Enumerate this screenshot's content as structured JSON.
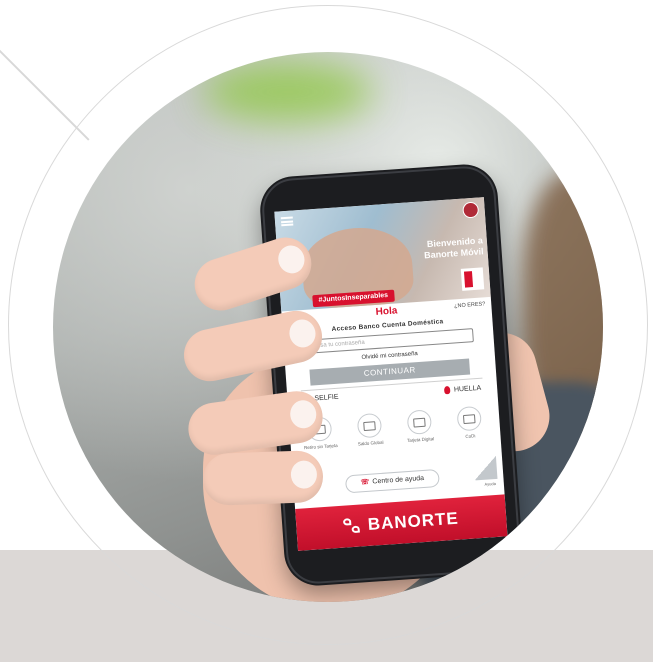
{
  "app": {
    "greeting": "Hola",
    "not_you": "¿NO ERES?",
    "access_text": "Acceso Banco Cuenta Doméstica",
    "password_placeholder": "Ingresa tu contraseña",
    "forgot_password": "Olvidé mi contraseña",
    "continue_label": "CONTINUAR",
    "selfie_label": "SELFIE",
    "fingerprint_label": "HUELLA",
    "hero": {
      "title": "Bienvenido a Banorte Móvil",
      "tagline": "#JuntosInseparables"
    },
    "quick_actions": [
      {
        "label": "Retiro sin Tarjeta",
        "icon": "cash-icon"
      },
      {
        "label": "Saldo Global",
        "icon": "money-icon"
      },
      {
        "label": "Tarjeta Digital",
        "icon": "card-icon"
      },
      {
        "label": "CoDi",
        "icon": "codi-icon"
      }
    ],
    "help_center": "Centro de ayuda",
    "curl_label": "Ayuda",
    "brand": "BANORTE"
  },
  "colors": {
    "brand_red": "#d8112e",
    "button_gray": "#a7adb1",
    "bottom_band": "#dcd8d6"
  }
}
